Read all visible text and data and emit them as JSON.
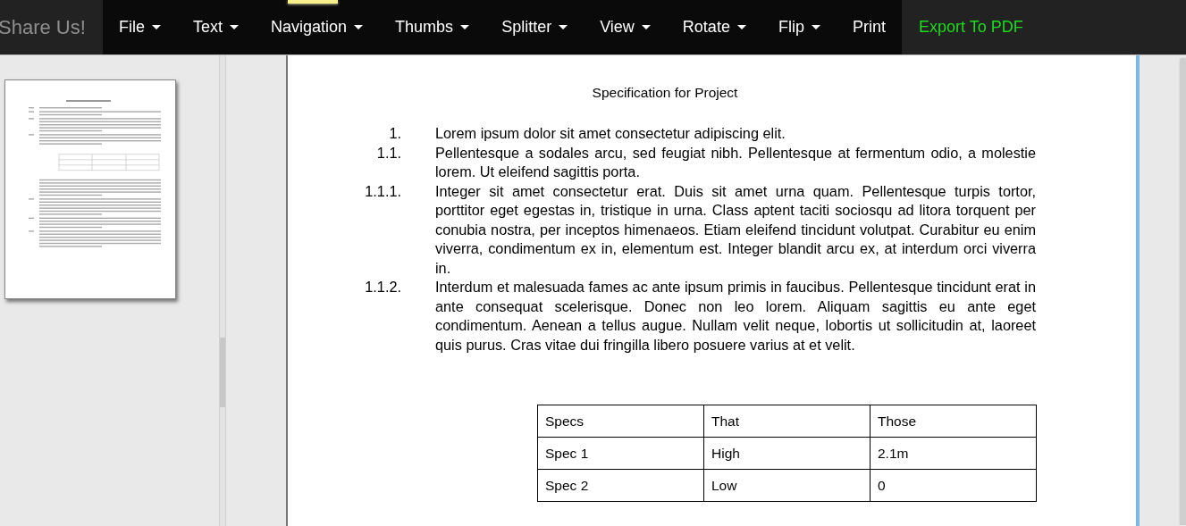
{
  "brand": "Share Us!",
  "menu": [
    {
      "label": "File",
      "kind": "dropdown"
    },
    {
      "label": "Text",
      "kind": "dropdown"
    },
    {
      "label": "Navigation",
      "kind": "dropdown"
    },
    {
      "label": "Thumbs",
      "kind": "dropdown"
    },
    {
      "label": "Splitter",
      "kind": "dropdown"
    },
    {
      "label": "View",
      "kind": "dropdown"
    },
    {
      "label": "Rotate",
      "kind": "dropdown"
    },
    {
      "label": "Flip",
      "kind": "dropdown"
    },
    {
      "label": "Print",
      "kind": "link"
    },
    {
      "label": "Export To PDF",
      "kind": "accent"
    }
  ],
  "document": {
    "title": "Specification for Project",
    "items": [
      {
        "number": "1.",
        "text": "Lorem ipsum dolor sit amet consectetur adipiscing elit."
      },
      {
        "number": "1.1.",
        "text": "Pellentesque a sodales arcu, sed feugiat nibh. Pellentesque at fermentum odio, a molestie lorem. Ut eleifend sagittis porta."
      },
      {
        "number": "1.1.1.",
        "text": "Integer sit amet consectetur erat. Duis sit amet urna quam. Pellentesque turpis  tortor, porttitor eget egestas in, tristique in urna. Class aptent taciti sociosqu ad litora torquent per conubia nostra, per inceptos himenaeos. Etiam eleifend tincidunt volutpat. Curabitur eu enim viverra, condimentum ex in, elementum est. Integer blandit arcu ex, at interdum orci viverra in."
      },
      {
        "number": "1.1.2.",
        "text": "Interdum et malesuada fames ac ante ipsum primis in faucibus. Pellentesque tincidunt erat in ante consequat scelerisque. Donec non leo lorem. Aliquam sagittis eu ante eget condimentum. Aenean a tellus augue. Nullam velit neque, lobortis ut sollicitudin at, laoreet quis purus. Cras vitae dui fringilla libero posuere varius at et velit."
      }
    ],
    "table": {
      "columns": [
        "Specs",
        "That",
        "Those"
      ],
      "rows": [
        [
          "Spec 1",
          "High",
          "2.1m"
        ],
        [
          "Spec 2",
          "Low",
          "0"
        ]
      ]
    }
  }
}
